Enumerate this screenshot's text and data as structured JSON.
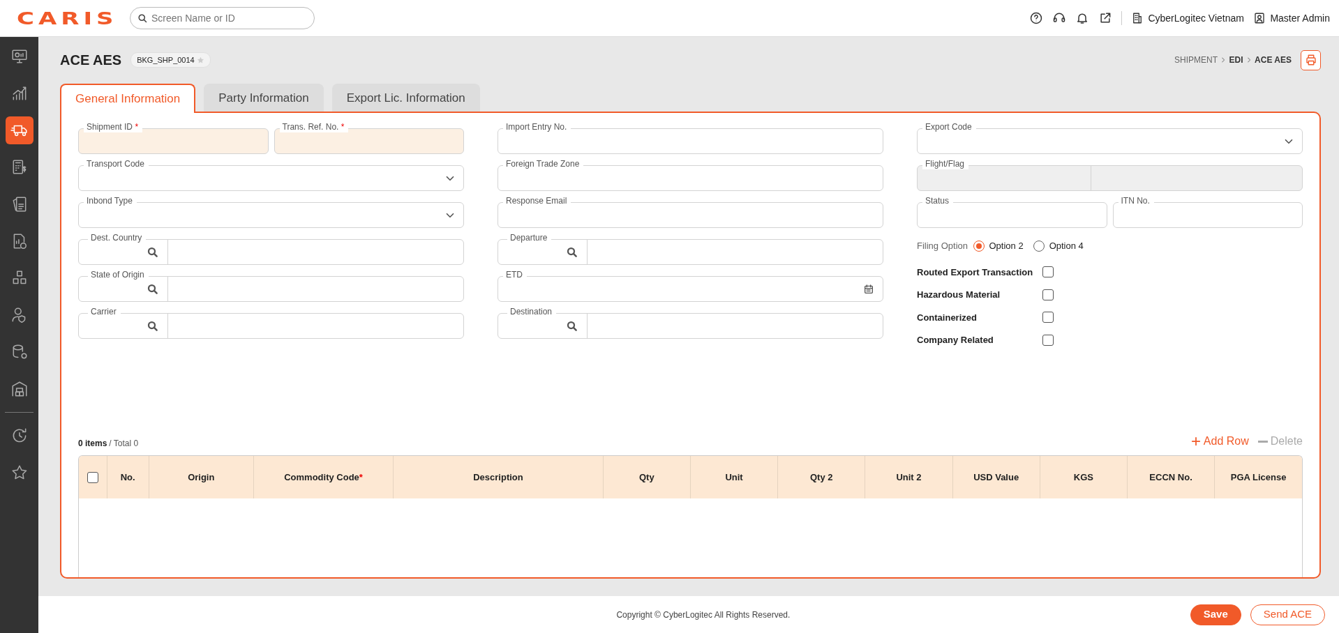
{
  "topbar": {
    "logo": "CARIS",
    "search": {
      "placeholder": "Screen Name or ID"
    },
    "company": "CyberLogitec Vietnam",
    "user": "Master Admin"
  },
  "sidebar": {
    "items": [
      {
        "selected": false
      },
      {
        "selected": false
      },
      {
        "selected": true
      },
      {
        "selected": false
      },
      {
        "selected": false
      },
      {
        "selected": false
      },
      {
        "selected": false
      },
      {
        "selected": false
      },
      {
        "selected": false
      },
      {
        "selected": false
      },
      {
        "selected": false
      },
      {
        "selected": false
      }
    ]
  },
  "page": {
    "title": "ACE AES",
    "tag": "BKG_SHP_0014",
    "favorite": false,
    "breadcrumb": [
      "SHIPMENT",
      "EDI",
      "ACE AES"
    ]
  },
  "tabs": [
    {
      "label": "General Information",
      "selected": true
    },
    {
      "label": "Party Information",
      "selected": false
    },
    {
      "label": "Export Lic. Information",
      "selected": false
    }
  ],
  "form": {
    "columns": [
      [
        [
          {
            "label": "Shipment ID",
            "kind": "locked",
            "required_mark": "*"
          },
          {
            "label": "Trans. Ref. No.",
            "kind": "locked",
            "required_mark": "*"
          }
        ],
        [
          {
            "label": "Transport Code",
            "kind": "select"
          }
        ],
        [
          {
            "label": "Inbond Type",
            "kind": "select"
          }
        ],
        [
          {
            "label": "Dest. Country",
            "kind": "search"
          }
        ],
        [
          {
            "label": "State of Origin",
            "kind": "search"
          }
        ],
        [
          {
            "label": "Carrier",
            "kind": "search"
          }
        ]
      ],
      [
        [
          {
            "label": "Import Entry No.",
            "kind": "text"
          }
        ],
        [
          {
            "label": "Foreign Trade Zone",
            "kind": "text"
          }
        ],
        [
          {
            "label": "Response Email",
            "kind": "text"
          }
        ],
        [
          {
            "label": "Departure",
            "kind": "search"
          }
        ],
        [
          {
            "label": "ETD",
            "kind": "date"
          }
        ],
        [
          {
            "label": "Destination",
            "kind": "search"
          }
        ]
      ],
      [
        [
          {
            "label": "Export Code",
            "kind": "select"
          }
        ],
        [
          {
            "label": "Flight/Flag",
            "kind": "split"
          }
        ],
        [
          {
            "label": "Status",
            "kind": "text"
          },
          {
            "label": "ITN No.",
            "kind": "text"
          }
        ]
      ]
    ],
    "filing_option": {
      "label": "Filing Option",
      "options": [
        {
          "label": "Option 2",
          "selected": true
        },
        {
          "label": "Option 4",
          "selected": false
        }
      ]
    },
    "checks": [
      {
        "label": "Routed Export Transaction",
        "checked": false
      },
      {
        "label": "Hazardous Material",
        "checked": false
      },
      {
        "label": "Containerized",
        "checked": false
      },
      {
        "label": "Company Related",
        "checked": false
      }
    ]
  },
  "grid": {
    "count": "0 items",
    "total": "/ Total 0",
    "actions": [
      {
        "label": "Add Row",
        "kind": "add",
        "disabled": false
      },
      {
        "label": "Delete",
        "kind": "delete",
        "disabled": true
      }
    ],
    "select_all": {
      "checked": false
    },
    "columns": [
      {
        "label": "No."
      },
      {
        "label": "Origin"
      },
      {
        "label": "Commodity Code",
        "required_mark": "*"
      },
      {
        "label": "Description"
      },
      {
        "label": "Qty"
      },
      {
        "label": "Unit"
      },
      {
        "label": "Qty 2"
      },
      {
        "label": "Unit 2"
      },
      {
        "label": "USD Value"
      },
      {
        "label": "KGS"
      },
      {
        "label": "ECCN No."
      },
      {
        "label": "PGA License"
      }
    ]
  },
  "footer": {
    "copyright": "Copyright © CyberLogitec All Rights Reserved.",
    "buttons": [
      {
        "label": "Save",
        "kind": "primary"
      },
      {
        "label": "Send ACE",
        "kind": "outline"
      }
    ]
  }
}
